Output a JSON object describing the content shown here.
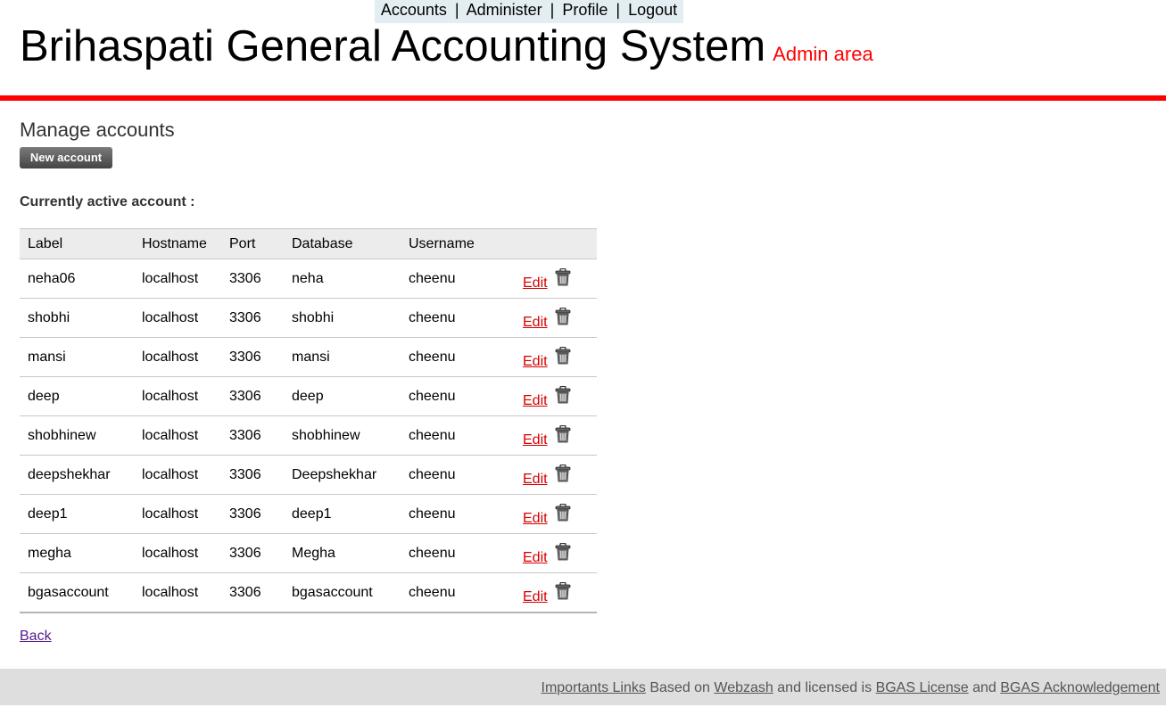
{
  "nav": {
    "accounts": "Accounts",
    "administer": "Administer",
    "profile": "Profile",
    "logout": "Logout",
    "separator": "|"
  },
  "header": {
    "title": "Brihaspati General Accounting System",
    "subtitle": "Admin area"
  },
  "main": {
    "title": "Manage accounts",
    "new_account_label": "New account",
    "active_account_label": "Currently active account :"
  },
  "table": {
    "columns": [
      "Label",
      "Hostname",
      "Port",
      "Database",
      "Username"
    ],
    "edit_label": "Edit",
    "rows": [
      {
        "label": "neha06",
        "hostname": "localhost",
        "port": "3306",
        "database": "neha",
        "username": "cheenu"
      },
      {
        "label": "shobhi",
        "hostname": "localhost",
        "port": "3306",
        "database": "shobhi",
        "username": "cheenu"
      },
      {
        "label": "mansi",
        "hostname": "localhost",
        "port": "3306",
        "database": "mansi",
        "username": "cheenu"
      },
      {
        "label": "deep",
        "hostname": "localhost",
        "port": "3306",
        "database": "deep",
        "username": "cheenu"
      },
      {
        "label": "shobhinew",
        "hostname": "localhost",
        "port": "3306",
        "database": "shobhinew",
        "username": "cheenu"
      },
      {
        "label": "deepshekhar",
        "hostname": "localhost",
        "port": "3306",
        "database": "Deepshekhar",
        "username": "cheenu"
      },
      {
        "label": "deep1",
        "hostname": "localhost",
        "port": "3306",
        "database": "deep1",
        "username": "cheenu"
      },
      {
        "label": "megha",
        "hostname": "localhost",
        "port": "3306",
        "database": "Megha",
        "username": "cheenu"
      },
      {
        "label": "bgasaccount",
        "hostname": "localhost",
        "port": "3306",
        "database": "bgasaccount",
        "username": "cheenu"
      }
    ]
  },
  "back_label": "Back",
  "footer": {
    "important_links": "Importants Links",
    "based_on": "Based on",
    "webzash": "Webzash",
    "licensed": "and licensed is",
    "license": "BGAS License",
    "and": "and",
    "acknowledgement": "BGAS Acknowledgement"
  },
  "colors": {
    "accent_red": "#ff0000",
    "edit_link": "#d40000",
    "nav_bg": "#e3eef2",
    "footer_bg": "#dedede"
  },
  "icons": {
    "delete": "trash-icon"
  }
}
